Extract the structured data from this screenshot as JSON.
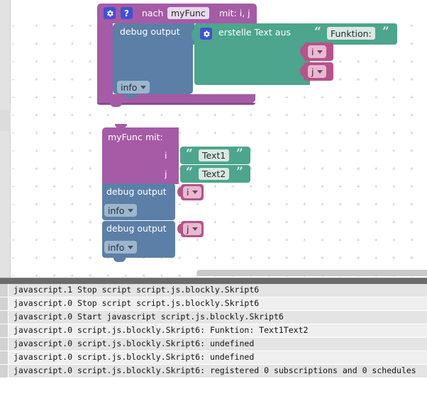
{
  "workspace": {
    "name": "blockly-workspace",
    "zoom_grid": true,
    "colors": {
      "procedure_purple": "#a55ba5",
      "debug_blue": "#5b7fa6",
      "text_green": "#4ca58c",
      "variable_pink": "#b5548a",
      "icon_blue": "#3f51d6"
    }
  },
  "call_block": {
    "gear_icon": "gear-icon",
    "help_icon": "question-mark-icon",
    "prefix_label": "nach",
    "function_name": "myFunc",
    "args_label": "mit: i, j",
    "debug": {
      "label": "debug output",
      "severity": "info",
      "severity_caret": "▼"
    },
    "create_text": {
      "gear_icon": "gear-icon",
      "label": "erstelle Text aus",
      "string_value": "Funktion:",
      "quote_open": "“",
      "quote_close": "”",
      "inputs": [
        {
          "name": "i",
          "caret": "▼"
        },
        {
          "name": "j",
          "caret": "▼"
        }
      ]
    }
  },
  "definition_block": {
    "function_name": "myFunc",
    "with_label": "mit:",
    "params": [
      {
        "name": "i",
        "quote_open": "“",
        "quote_close": "”",
        "value": "Text1"
      },
      {
        "name": "j",
        "quote_open": "“",
        "quote_close": "”",
        "value": "Text2"
      }
    ],
    "statements": [
      {
        "label": "debug output",
        "severity": "info",
        "severity_caret": "▼",
        "variable": "i",
        "variable_caret": "▼"
      },
      {
        "label": "debug output",
        "severity": "info",
        "severity_caret": "▼",
        "variable": "j",
        "variable_caret": "▼"
      }
    ]
  },
  "scrollbar": {
    "name": "horizontal-scrollbar",
    "orientation": "horizontal"
  },
  "console": {
    "lines": [
      "javascript.1 Stop script script.js.blockly.Skript6",
      "javascript.0 Stop script script.js.blockly.Skript6",
      "javascript.0 Start javascript script.js.blockly.Skript6",
      "javascript.0 script.js.blockly.Skript6: Funktion: Text1Text2",
      "javascript.0 script.js.blockly.Skript6: undefined",
      "javascript.0 script.js.blockly.Skript6: undefined",
      "javascript.0 script.js.blockly.Skript6: registered 0 subscriptions and 0 schedules"
    ]
  }
}
